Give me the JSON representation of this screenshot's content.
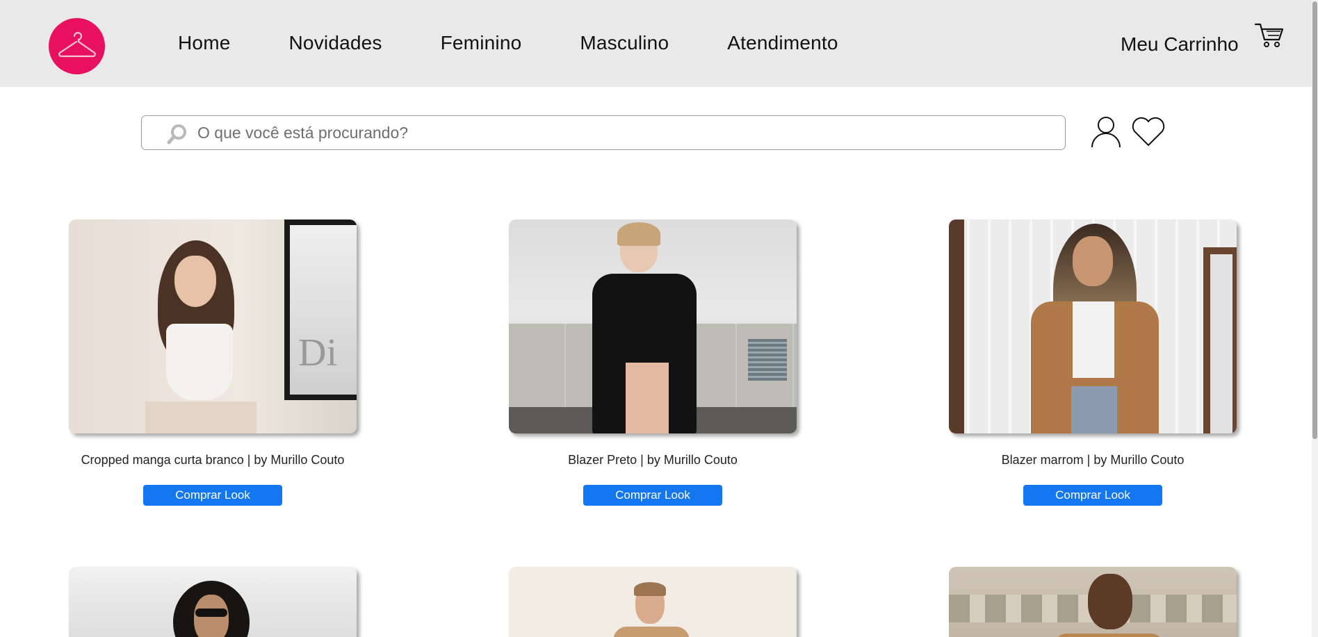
{
  "header": {
    "logo_icon": "hanger-icon",
    "brand_color": "#e8115f",
    "nav": [
      {
        "label": "Home"
      },
      {
        "label": "Novidades"
      },
      {
        "label": "Feminino"
      },
      {
        "label": "Masculino"
      },
      {
        "label": "Atendimento"
      }
    ],
    "cart_label": "Meu Carrinho",
    "cart_icon": "cart-icon"
  },
  "search": {
    "placeholder": "O que você está procurando?",
    "value": "",
    "icon": "search-icon"
  },
  "actions": {
    "user_icon": "user-icon",
    "favorites_icon": "heart-icon"
  },
  "products": [
    {
      "name": "Cropped manga curta branco | by Murillo Couto",
      "button": "Comprar Look"
    },
    {
      "name": "Blazer Preto | by Murillo Couto",
      "button": "Comprar Look"
    },
    {
      "name": "Blazer marrom | by Murillo Couto",
      "button": "Comprar Look"
    }
  ],
  "button_color": "#1477f2"
}
